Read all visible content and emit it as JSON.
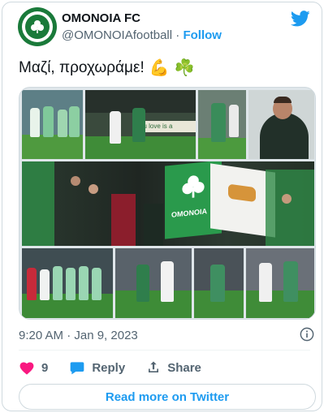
{
  "author": {
    "name": "OMONOIA FC",
    "handle": "@OMONOIAfootball",
    "separator": "·",
    "follow_label": "Follow"
  },
  "tweet": {
    "text": "Μαζί, προχωράμε!",
    "emojis": [
      "💪",
      "☘️"
    ]
  },
  "media": {
    "banner_text": "you love is a",
    "flag_text": "OMONOIA"
  },
  "meta": {
    "timestamp": "9:20 AM · Jan 9, 2023"
  },
  "actions": {
    "like_count": "9",
    "reply_label": "Reply",
    "share_label": "Share"
  },
  "cta": {
    "read_more_label": "Read more on Twitter"
  },
  "colors": {
    "accent": "#1d9bf0",
    "like": "#f91880",
    "club_green": "#1a7a3a"
  }
}
